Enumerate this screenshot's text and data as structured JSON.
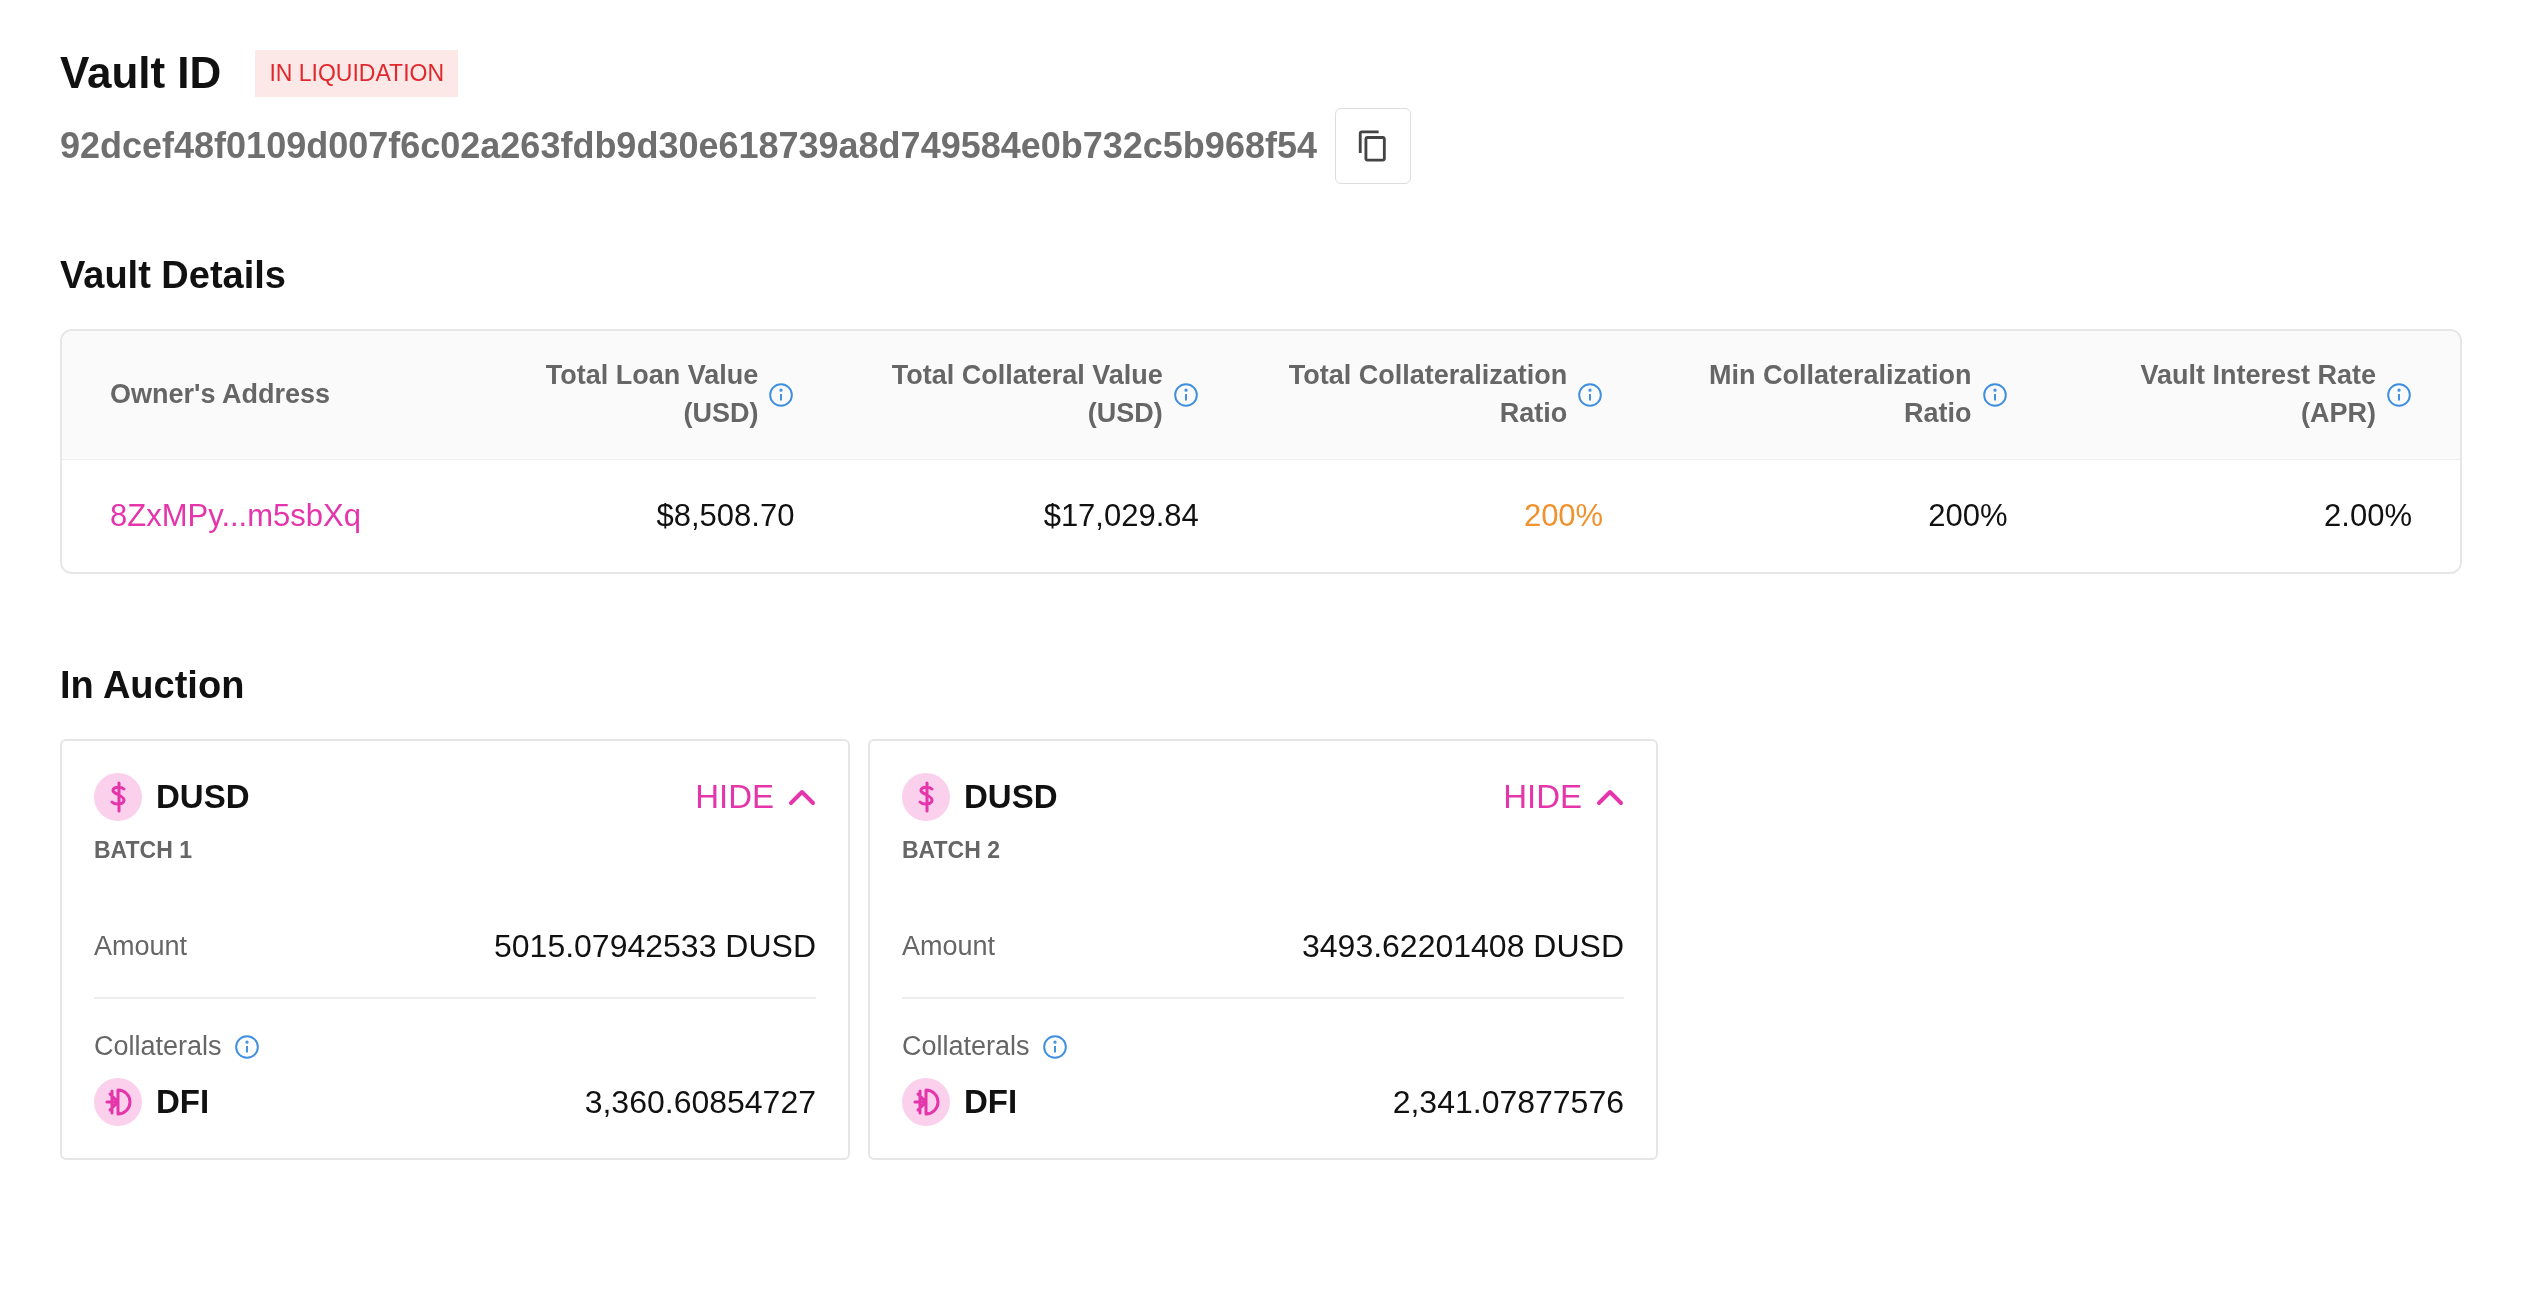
{
  "vault": {
    "title": "Vault ID",
    "status": {
      "label": "IN LIQUIDATION",
      "kind": "danger"
    },
    "id": "92dcef48f0109d007f6c02a263fdb9d30e618739a8d749584e0b732c5b968f54"
  },
  "details": {
    "title": "Vault Details",
    "columns": [
      {
        "label": "Owner's Address",
        "info": false
      },
      {
        "label": "Total Loan Value (USD)",
        "info": true
      },
      {
        "label": "Total Collateral Value (USD)",
        "info": true
      },
      {
        "label": "Total Collateralization Ratio",
        "info": true
      },
      {
        "label": "Min Collateralization Ratio",
        "info": true
      },
      {
        "label": "Vault Interest Rate (APR)",
        "info": true
      }
    ],
    "row": [
      {
        "text": "8ZxMPy...m5sbXq",
        "kind": "link"
      },
      {
        "text": "$8,508.70",
        "kind": "plain"
      },
      {
        "text": "$17,029.84",
        "kind": "plain"
      },
      {
        "text": "200%",
        "kind": "warning"
      },
      {
        "text": "200%",
        "kind": "plain"
      },
      {
        "text": "2.00%",
        "kind": "plain"
      }
    ]
  },
  "auction": {
    "title": "In Auction",
    "batches": [
      {
        "token": "DUSD",
        "kind": "dusd",
        "toggle": "HIDE",
        "expanded": true,
        "batch": "BATCH 1",
        "amount_label": "Amount",
        "amount": "5015.07942533 DUSD",
        "collaterals_label": "Collaterals",
        "collaterals": [
          {
            "token": "DFI",
            "kind": "dfi",
            "amount": "3,360.60854727"
          }
        ]
      },
      {
        "token": "DUSD",
        "kind": "dusd",
        "toggle": "HIDE",
        "expanded": true,
        "batch": "BATCH 2",
        "amount_label": "Amount",
        "amount": "3493.62201408 DUSD",
        "collaterals_label": "Collaterals",
        "collaterals": [
          {
            "token": "DFI",
            "kind": "dfi",
            "amount": "2,341.07877576"
          }
        ]
      }
    ]
  }
}
